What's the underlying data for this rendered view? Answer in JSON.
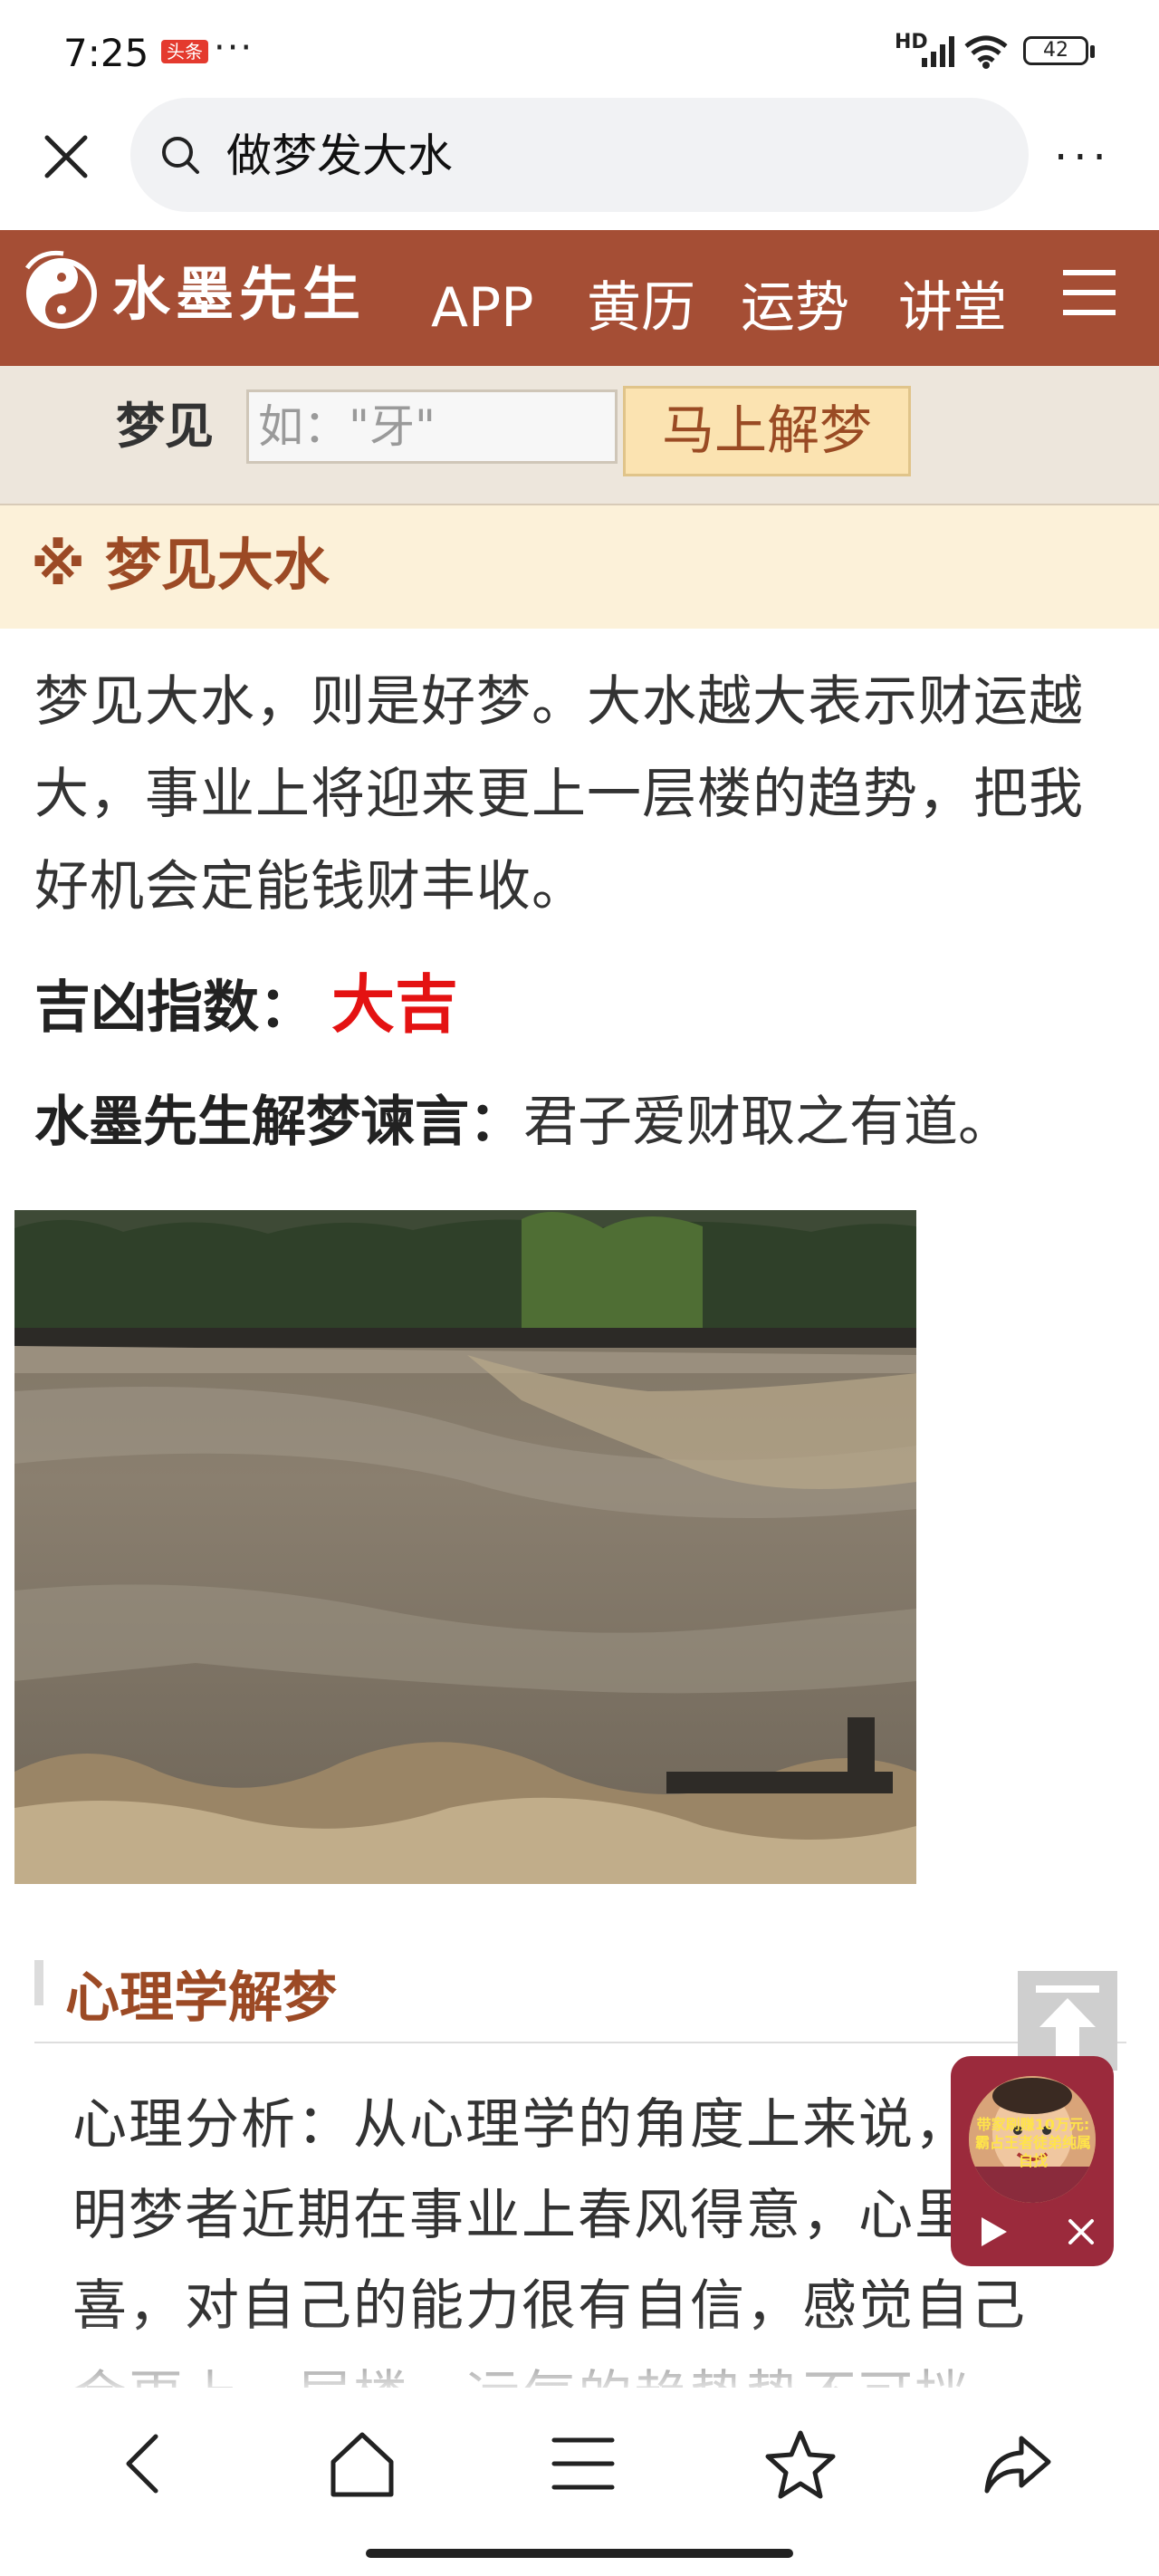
{
  "status_bar": {
    "time": "7:25",
    "app_badge": "头条",
    "dots": "···",
    "network": "HD",
    "battery": "42"
  },
  "browser": {
    "search_query": "做梦发大水",
    "more": "···"
  },
  "site_header": {
    "logo_text": "水墨先生",
    "nav": [
      "APP",
      "黄历",
      "运势",
      "讲堂"
    ]
  },
  "dream_search": {
    "label": "梦见",
    "placeholder": "如：\"牙\"",
    "button": "马上解梦"
  },
  "section": {
    "title": "※ 梦见大水"
  },
  "content": {
    "description": "梦见大水，则是好梦。大水越大表示财运越大，事业上将迎来更上一层楼的趋势，把我好机会定能钱财丰收。",
    "luck_label": "吉凶指数：",
    "luck_value": "大吉",
    "proverb_label": "水墨先生解梦谏言：",
    "proverb_text": "君子爱财取之有道。"
  },
  "psychology": {
    "title": "心理学解梦",
    "text": "心理分析：从心理学的角度上来说，说明梦者近期在事业上春风得意，心里欢喜，对自己的能力很有自信，感觉自己会更上一层楼，运气的趋势势不可挡。"
  },
  "video_widget": {
    "caption": "带家刷赚10万元:霸占王者徒弟纯属自找"
  },
  "colors": {
    "header_bg": "#a54e35",
    "section_bg": "#fcf1d9",
    "accent_brown": "#9c4a25",
    "luck_red": "#e41212",
    "button_bg": "#fbe3b1"
  }
}
